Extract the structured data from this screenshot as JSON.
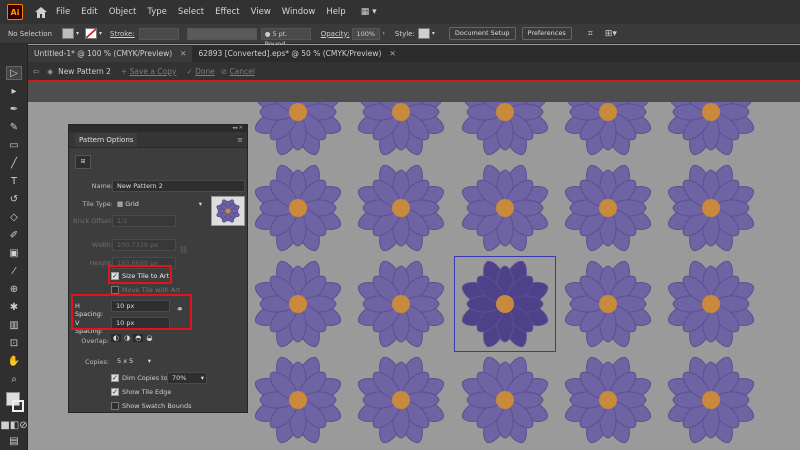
{
  "app": {
    "logo": "Ai",
    "menus": [
      "File",
      "Edit",
      "Object",
      "Type",
      "Select",
      "Effect",
      "View",
      "Window",
      "Help"
    ]
  },
  "control": {
    "selection": "No Selection",
    "stroke_label": "Stroke:",
    "brush": "5 pt. Round",
    "opacity_label": "Opacity:",
    "opacity": "100%",
    "style_label": "Style:",
    "doc_setup": "Document Setup",
    "preferences": "Preferences"
  },
  "tabs": [
    {
      "label": "Untitled-1* @ 100 % (CMYK/Preview)",
      "active": true
    },
    {
      "label": "62893 [Converted].eps* @ 50 % (CMYK/Preview)",
      "active": false
    }
  ],
  "pattern_bar": {
    "name": "New Pattern 2",
    "save_copy": "Save a Copy",
    "done": "Done",
    "cancel": "Cancel"
  },
  "panel": {
    "title": "Pattern Options",
    "name_label": "Name:",
    "name_value": "New Pattern 2",
    "tile_type_label": "Tile Type:",
    "tile_type_value": "Grid",
    "brick_label": "Brick Offset:",
    "brick_value": "1/2",
    "width_label": "Width:",
    "width_value": "200.7329 px",
    "height_label": "Height:",
    "height_value": "193.6689 px",
    "size_tile": "Size Tile to Art",
    "move_tile": "Move Tile with Art",
    "h_label": "H Spacing:",
    "h_value": "10 px",
    "v_label": "V Spacing:",
    "v_value": "10 px",
    "overlap_label": "Overlap:",
    "copies_label": "Copies:",
    "copies_value": "5 x 5",
    "dim_label": "Dim Copies to:",
    "dim_value": "70%",
    "show_edge": "Show Tile Edge",
    "show_bounds": "Show Swatch Bounds"
  },
  "colors": {
    "petal": "#6e63a3",
    "petal_edge": "#5a5090",
    "center": "#c98a3b",
    "selected_petal": "#4e4189",
    "highlight": "#e0151c"
  }
}
